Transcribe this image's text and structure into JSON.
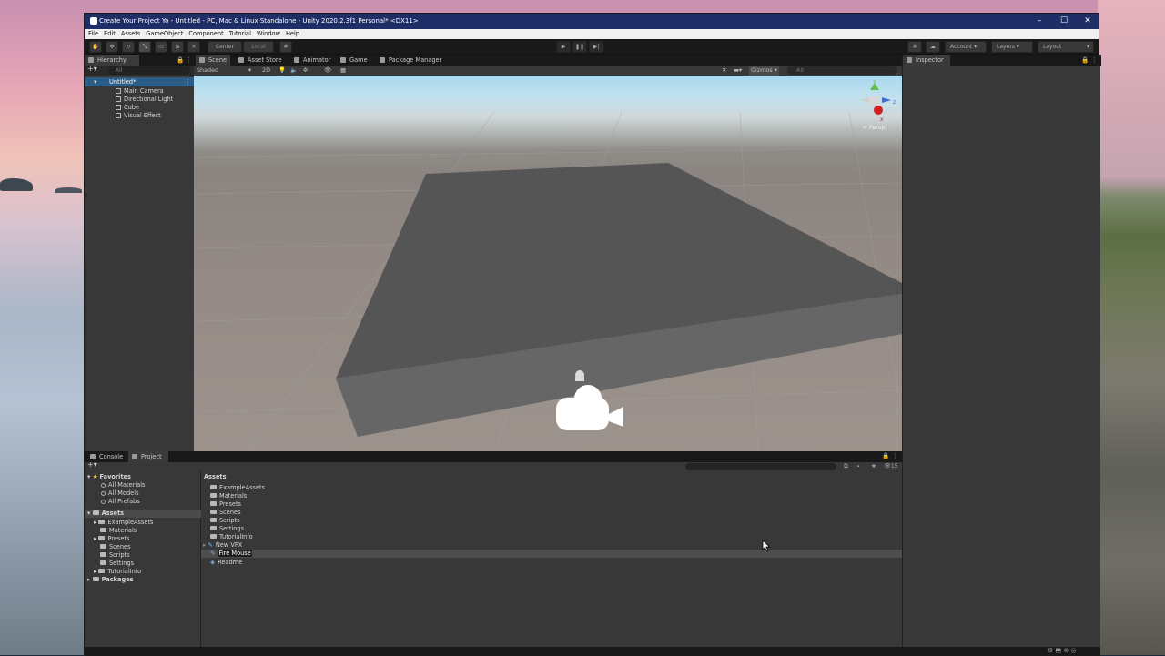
{
  "window": {
    "title": "Create Your Project Yo - Untitled - PC, Mac & Linux Standalone - Unity 2020.2.3f1 Personal* <DX11>",
    "minimize": "–",
    "maximize": "☐",
    "close": "✕"
  },
  "menu": [
    "File",
    "Edit",
    "Assets",
    "GameObject",
    "Component",
    "Tutorial",
    "Window",
    "Help"
  ],
  "toolbar": {
    "center": "Center",
    "local": "Local",
    "account": "Account",
    "layers": "Layers",
    "layout": "Layout"
  },
  "hierarchy": {
    "tab": "Hierarchy",
    "search_placeholder": "All",
    "scene": "Untitled*",
    "items": [
      "Main Camera",
      "Directional Light",
      "Cube",
      "Visual Effect"
    ]
  },
  "scene_tabs": [
    "Scene",
    "Asset Store",
    "Animator",
    "Game",
    "Package Manager"
  ],
  "scene_toolbar": {
    "shading": "Shaded",
    "mode_2d": "2D",
    "gizmos": "Gizmos",
    "search_placeholder": "All"
  },
  "gizmo": {
    "label": "< Persp",
    "y": "y",
    "x": "x",
    "z": "z"
  },
  "inspector": {
    "tab": "Inspector"
  },
  "bottom_tabs": [
    "Console",
    "Project"
  ],
  "project": {
    "count": "15",
    "favorites": {
      "label": "Favorites",
      "items": [
        "All Materials",
        "All Models",
        "All Prefabs"
      ]
    },
    "assets": {
      "label": "Assets",
      "items": [
        "ExampleAssets",
        "Materials",
        "Presets",
        "Scenes",
        "Scripts",
        "Settings",
        "TutorialInfo"
      ]
    },
    "packages": "Packages",
    "breadcrumb": "Assets",
    "list": {
      "folders": [
        "ExampleAssets",
        "Materials",
        "Presets",
        "Scenes",
        "Scripts",
        "Settings",
        "TutorialInfo"
      ],
      "files": [
        "New VFX",
        "Fire Mouse",
        "Readme"
      ]
    }
  }
}
